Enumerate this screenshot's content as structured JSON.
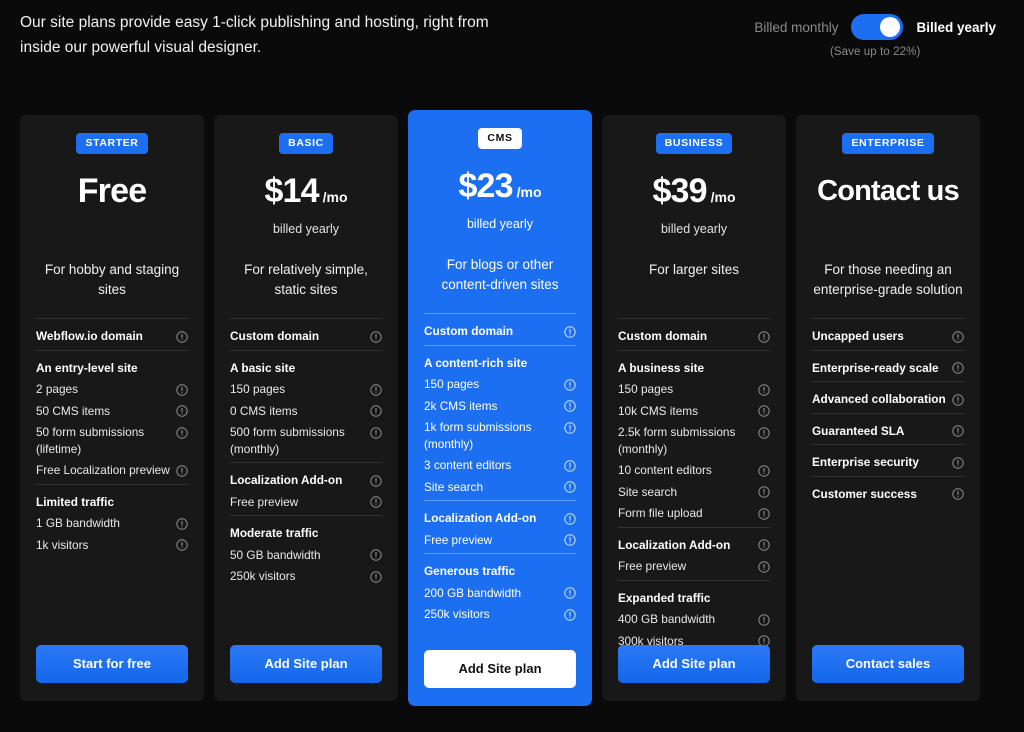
{
  "header": {
    "intro": "Our site plans provide easy 1-click publishing and hosting, right from inside our powerful visual designer.",
    "billing": {
      "monthly_label": "Billed monthly",
      "yearly_label": "Billed yearly",
      "toggle_state": "yearly",
      "save_note": "(Save up to 22%)"
    }
  },
  "colors": {
    "page_bg": "#0a0a0a",
    "card_bg": "#181818",
    "accent": "#1d6ff2",
    "featured_bg": "#1d6ff2",
    "divider": "#333333"
  },
  "icons": {
    "info": "info-icon"
  },
  "plans": [
    {
      "badge": "STARTER",
      "price": "Free",
      "price_suffix": "",
      "billed": "",
      "tagline": "For hobby and staging sites",
      "featured": false,
      "cta": "Start for free",
      "sections": [
        {
          "items": [
            {
              "text": "Webflow.io domain",
              "head": true,
              "info": true
            }
          ]
        },
        {
          "items": [
            {
              "text": "An entry-level site",
              "head": true,
              "info": false
            },
            {
              "text": "2 pages",
              "head": false,
              "info": true
            },
            {
              "text": "50 CMS items",
              "head": false,
              "info": true
            },
            {
              "text": "50 form submissions (lifetime)",
              "head": false,
              "info": true
            },
            {
              "text": "Free Localization preview",
              "head": false,
              "info": true
            }
          ]
        },
        {
          "items": [
            {
              "text": "Limited traffic",
              "head": true,
              "info": false
            },
            {
              "text": "1 GB bandwidth",
              "head": false,
              "info": true
            },
            {
              "text": "1k visitors",
              "head": false,
              "info": true
            }
          ]
        }
      ]
    },
    {
      "badge": "BASIC",
      "price": "$14",
      "price_suffix": "/mo",
      "billed": "billed yearly",
      "tagline": "For relatively simple, static sites",
      "featured": false,
      "cta": "Add Site plan",
      "sections": [
        {
          "items": [
            {
              "text": "Custom domain",
              "head": true,
              "info": true
            }
          ]
        },
        {
          "items": [
            {
              "text": "A basic site",
              "head": true,
              "info": false
            },
            {
              "text": "150 pages",
              "head": false,
              "info": true
            },
            {
              "text": "0 CMS items",
              "head": false,
              "info": true
            },
            {
              "text": "500 form submissions (monthly)",
              "head": false,
              "info": true
            }
          ]
        },
        {
          "items": [
            {
              "text": "Localization Add-on",
              "head": true,
              "info": true
            },
            {
              "text": "Free preview",
              "head": false,
              "info": true
            }
          ]
        },
        {
          "items": [
            {
              "text": "Moderate traffic",
              "head": true,
              "info": false
            },
            {
              "text": "50 GB bandwidth",
              "head": false,
              "info": true
            },
            {
              "text": "250k visitors",
              "head": false,
              "info": true
            }
          ]
        }
      ]
    },
    {
      "badge": "CMS",
      "price": "$23",
      "price_suffix": "/mo",
      "billed": "billed yearly",
      "tagline": "For blogs or other content-driven sites",
      "featured": true,
      "cta": "Add Site plan",
      "sections": [
        {
          "items": [
            {
              "text": "Custom domain",
              "head": true,
              "info": true
            }
          ]
        },
        {
          "items": [
            {
              "text": "A content-rich site",
              "head": true,
              "info": false
            },
            {
              "text": "150 pages",
              "head": false,
              "info": true
            },
            {
              "text": "2k CMS items",
              "head": false,
              "info": true
            },
            {
              "text": "1k form submissions (monthly)",
              "head": false,
              "info": true
            },
            {
              "text": "3 content editors",
              "head": false,
              "info": true
            },
            {
              "text": "Site search",
              "head": false,
              "info": true
            }
          ]
        },
        {
          "items": [
            {
              "text": "Localization Add-on",
              "head": true,
              "info": true
            },
            {
              "text": "Free preview",
              "head": false,
              "info": true
            }
          ]
        },
        {
          "items": [
            {
              "text": "Generous traffic",
              "head": true,
              "info": false
            },
            {
              "text": "200 GB bandwidth",
              "head": false,
              "info": true
            },
            {
              "text": "250k visitors",
              "head": false,
              "info": true
            }
          ]
        }
      ]
    },
    {
      "badge": "BUSINESS",
      "price": "$39",
      "price_suffix": "/mo",
      "billed": "billed yearly",
      "tagline": "For larger sites",
      "featured": false,
      "cta": "Add Site plan",
      "sections": [
        {
          "items": [
            {
              "text": "Custom domain",
              "head": true,
              "info": true
            }
          ]
        },
        {
          "items": [
            {
              "text": "A business site",
              "head": true,
              "info": false
            },
            {
              "text": "150 pages",
              "head": false,
              "info": true
            },
            {
              "text": "10k CMS items",
              "head": false,
              "info": true
            },
            {
              "text": "2.5k form submissions (monthly)",
              "head": false,
              "info": true
            },
            {
              "text": "10 content editors",
              "head": false,
              "info": true
            },
            {
              "text": "Site search",
              "head": false,
              "info": true
            },
            {
              "text": "Form file upload",
              "head": false,
              "info": true
            }
          ]
        },
        {
          "items": [
            {
              "text": "Localization Add-on",
              "head": true,
              "info": true
            },
            {
              "text": "Free preview",
              "head": false,
              "info": true
            }
          ]
        },
        {
          "items": [
            {
              "text": "Expanded traffic",
              "head": true,
              "info": false
            },
            {
              "text": "400 GB bandwidth",
              "head": false,
              "info": true
            },
            {
              "text": "300k visitors",
              "head": false,
              "info": true
            }
          ]
        }
      ]
    },
    {
      "badge": "ENTERPRISE",
      "price": "Contact us",
      "price_suffix": "",
      "billed": "",
      "tagline": "For those needing an enterprise-grade solution",
      "featured": false,
      "cta": "Contact sales",
      "sections": [
        {
          "items": [
            {
              "text": "Uncapped users",
              "head": true,
              "info": true
            }
          ]
        },
        {
          "items": [
            {
              "text": "Enterprise-ready scale",
              "head": true,
              "info": true
            }
          ]
        },
        {
          "items": [
            {
              "text": "Advanced collaboration",
              "head": true,
              "info": true
            }
          ]
        },
        {
          "items": [
            {
              "text": "Guaranteed SLA",
              "head": true,
              "info": true
            }
          ]
        },
        {
          "items": [
            {
              "text": "Enterprise security",
              "head": true,
              "info": true
            }
          ]
        },
        {
          "items": [
            {
              "text": "Customer success",
              "head": true,
              "info": true
            }
          ]
        }
      ]
    }
  ]
}
